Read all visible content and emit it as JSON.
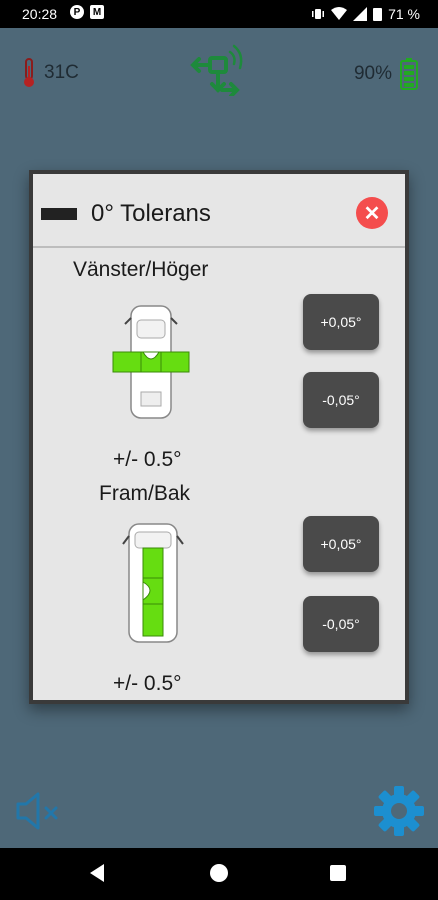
{
  "status_bar": {
    "time": "20:28",
    "battery": "71 %"
  },
  "header": {
    "temperature": "31C",
    "battery_level": "90%"
  },
  "dialog": {
    "title": "0° Tolerans",
    "sections": [
      {
        "label": "Vänster/Höger",
        "tolerance": "+/- 0.5°",
        "plus_button": "+0,05°",
        "minus_button": "-0,05°"
      },
      {
        "label": "Fram/Bak",
        "tolerance": "+/- 0.5°",
        "plus_button": "+0,05°",
        "minus_button": "-0,05°"
      }
    ]
  },
  "colors": {
    "accent": "#2b9ecf",
    "level_green": "#66dd11",
    "close": "#f44d4d"
  }
}
